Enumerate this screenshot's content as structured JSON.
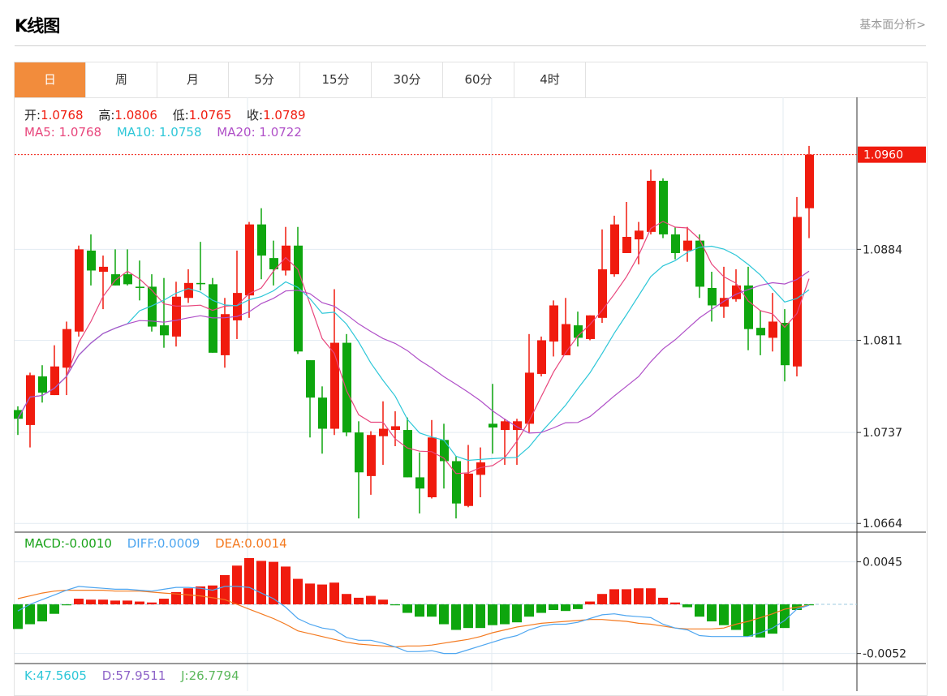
{
  "header": {
    "title": "K线图",
    "link": "基本面分析>"
  },
  "tabs": [
    {
      "label": "日",
      "active": true
    },
    {
      "label": "周"
    },
    {
      "label": "月"
    },
    {
      "label": "5分"
    },
    {
      "label": "15分"
    },
    {
      "label": "30分"
    },
    {
      "label": "60分"
    },
    {
      "label": "4时"
    }
  ],
  "ohlc_legend": {
    "open_label": "开:",
    "open": "1.0768",
    "high_label": "高:",
    "high": "1.0806",
    "low_label": "低:",
    "low": "1.0765",
    "close_label": "收:",
    "close": "1.0789"
  },
  "ma_legend": {
    "ma5_label": "MA5:",
    "ma5": "1.0768",
    "ma10_label": "MA10:",
    "ma10": "1.0758",
    "ma20_label": "MA20:",
    "ma20": "1.0722"
  },
  "macd_legend": {
    "macd_label": "MACD:",
    "macd": "-0.0010",
    "diff_label": "DIFF:",
    "diff": "0.0009",
    "dea_label": "DEA:",
    "dea": "0.0014"
  },
  "kdj_legend": {
    "k_label": "K:",
    "k": "47.5605",
    "d_label": "D:",
    "d": "57.9511",
    "j_label": "J:",
    "j": "26.7794"
  },
  "colors": {
    "up": "#f01b0e",
    "down": "#0ea60e",
    "ma5": "#e8467c",
    "ma10": "#2ec7d8",
    "ma20": "#b050c8",
    "diff": "#4ea6f0",
    "dea": "#f47a20",
    "active_tab": "#f28c3c"
  },
  "chart_data": [
    {
      "type": "candlestick",
      "title": "K线图",
      "ylim": [
        1.0657,
        1.1006
      ],
      "yticks": [
        "1.0884",
        "1.0811",
        "1.0737",
        "1.0664"
      ],
      "last_price": "1.0960",
      "ohlc": [
        [
          1.0755,
          1.0758,
          1.0735,
          1.0748
        ],
        [
          1.0743,
          1.0785,
          1.0725,
          1.0783
        ],
        [
          1.0782,
          1.0791,
          1.0761,
          1.0769
        ],
        [
          1.0767,
          1.0807,
          1.0767,
          1.079
        ],
        [
          1.0789,
          1.0826,
          1.0767,
          1.082
        ],
        [
          1.0818,
          1.0887,
          1.0814,
          1.0884
        ],
        [
          1.0883,
          1.0896,
          1.0855,
          1.0867
        ],
        [
          1.0866,
          1.0879,
          1.0836,
          1.087
        ],
        [
          1.0864,
          1.0884,
          1.0855,
          1.0855
        ],
        [
          1.0864,
          1.0884,
          1.0855,
          1.0856
        ],
        [
          1.0854,
          1.0875,
          1.0843,
          1.0853
        ],
        [
          1.0854,
          1.0864,
          1.0818,
          1.0822
        ],
        [
          1.0823,
          1.0861,
          1.0805,
          1.0815
        ],
        [
          1.0814,
          1.0858,
          1.0806,
          1.0846
        ],
        [
          1.0845,
          1.0868,
          1.0841,
          1.0857
        ],
        [
          1.0857,
          1.089,
          1.0851,
          1.0856
        ],
        [
          1.0856,
          1.0861,
          1.0801,
          1.0801
        ],
        [
          1.0799,
          1.0845,
          1.0789,
          1.0832
        ],
        [
          1.0827,
          1.0883,
          1.0812,
          1.0849
        ],
        [
          1.0847,
          1.0906,
          1.0829,
          1.0904
        ],
        [
          1.0904,
          1.0917,
          1.086,
          1.0879
        ],
        [
          1.0877,
          1.0891,
          1.0855,
          1.0868
        ],
        [
          1.0867,
          1.0902,
          1.0863,
          1.0887
        ],
        [
          1.0887,
          1.0902,
          1.08,
          1.0802
        ],
        [
          1.0795,
          1.0795,
          1.0733,
          1.0765
        ],
        [
          1.0765,
          1.0774,
          1.072,
          1.074
        ],
        [
          1.074,
          1.0852,
          1.0735,
          1.0809
        ],
        [
          1.0809,
          1.0816,
          1.0734,
          1.0737
        ],
        [
          1.0737,
          1.0746,
          1.0668,
          1.0705
        ],
        [
          1.0702,
          1.0738,
          1.0687,
          1.0735
        ],
        [
          1.0734,
          1.0762,
          1.0711,
          1.074
        ],
        [
          1.0739,
          1.0754,
          1.0726,
          1.0742
        ],
        [
          1.0739,
          1.0749,
          1.0701,
          1.0701
        ],
        [
          1.0701,
          1.0721,
          1.0672,
          1.0692
        ],
        [
          1.0685,
          1.0747,
          1.0684,
          1.0733
        ],
        [
          1.0731,
          1.0744,
          1.0692,
          1.0714
        ],
        [
          1.0714,
          1.0718,
          1.0668,
          1.068
        ],
        [
          1.0678,
          1.0727,
          1.0677,
          1.0704
        ],
        [
          1.0703,
          1.0725,
          1.0685,
          1.0713
        ],
        [
          1.0744,
          1.0776,
          1.072,
          1.0741
        ],
        [
          1.0739,
          1.0748,
          1.0711,
          1.0746
        ],
        [
          1.0739,
          1.0748,
          1.0711,
          1.0746
        ],
        [
          1.0744,
          1.0816,
          1.0737,
          1.0785
        ],
        [
          1.0784,
          1.0814,
          1.0782,
          1.0811
        ],
        [
          1.081,
          1.0843,
          1.0798,
          1.0839
        ],
        [
          1.0799,
          1.0845,
          1.0799,
          1.0824
        ],
        [
          1.0823,
          1.0834,
          1.0806,
          1.0813
        ],
        [
          1.0812,
          1.0831,
          1.0811,
          1.0831
        ],
        [
          1.0829,
          1.09,
          1.0825,
          1.0868
        ],
        [
          1.0864,
          1.0911,
          1.0862,
          1.0904
        ],
        [
          1.0881,
          1.0922,
          1.0881,
          1.0894
        ],
        [
          1.0892,
          1.0906,
          1.0872,
          1.0899
        ],
        [
          1.0898,
          1.0948,
          1.0896,
          1.0939
        ],
        [
          1.0939,
          1.0941,
          1.0893,
          1.0896
        ],
        [
          1.0896,
          1.0902,
          1.0876,
          1.0881
        ],
        [
          1.0883,
          1.0902,
          1.0874,
          1.0891
        ],
        [
          1.0891,
          1.0896,
          1.0845,
          1.0854
        ],
        [
          1.0853,
          1.0866,
          1.0826,
          1.0839
        ],
        [
          1.0838,
          1.087,
          1.0829,
          1.0845
        ],
        [
          1.0844,
          1.0868,
          1.0842,
          1.0855
        ],
        [
          1.0855,
          1.087,
          1.0803,
          1.082
        ],
        [
          1.0821,
          1.0835,
          1.0799,
          1.0815
        ],
        [
          1.0813,
          1.0849,
          1.0802,
          1.0826
        ],
        [
          1.0825,
          1.0836,
          1.0778,
          1.0791
        ],
        [
          1.079,
          1.0926,
          1.0782,
          1.091
        ],
        [
          1.0917,
          1.0967,
          1.0893,
          1.096
        ]
      ]
    },
    {
      "type": "bar+line",
      "title": "MACD",
      "ylim": [
        -0.00626,
        0.00764
      ],
      "yticks": [
        "0.0045",
        "-0.0052"
      ],
      "hist": [
        -0.0026,
        -0.0021,
        -0.0018,
        -0.001,
        -0.0001,
        0.0006,
        0.0005,
        0.0005,
        0.0004,
        0.0004,
        0.0003,
        0.0002,
        0.0006,
        0.0013,
        0.0017,
        0.0019,
        0.002,
        0.0031,
        0.0041,
        0.0049,
        0.0046,
        0.0045,
        0.004,
        0.0027,
        0.0022,
        0.0021,
        0.0023,
        0.0011,
        0.0007,
        0.0009,
        0.0005,
        -0.0001,
        -0.0009,
        -0.0013,
        -0.0013,
        -0.0021,
        -0.0027,
        -0.0025,
        -0.0025,
        -0.0022,
        -0.0021,
        -0.0019,
        -0.0013,
        -0.0009,
        -0.0006,
        -0.0007,
        -0.0005,
        0.0003,
        0.0011,
        0.0016,
        0.0016,
        0.0017,
        0.0017,
        0.0007,
        0.0002,
        -0.0003,
        -0.0013,
        -0.0018,
        -0.0022,
        -0.0027,
        -0.0034,
        -0.0035,
        -0.0031,
        -0.0025,
        -0.0006,
        -0.0001
      ],
      "diff": [
        -0.0007,
        0.0,
        0.0005,
        0.001,
        0.0015,
        0.0019,
        0.0018,
        0.0017,
        0.0016,
        0.0016,
        0.0015,
        0.0014,
        0.0016,
        0.0018,
        0.0018,
        0.0017,
        0.0015,
        0.0019,
        0.0019,
        0.0018,
        0.0012,
        0.0006,
        -0.0003,
        -0.0015,
        -0.0021,
        -0.0025,
        -0.0027,
        -0.0035,
        -0.0038,
        -0.0038,
        -0.0041,
        -0.0045,
        -0.005,
        -0.005,
        -0.0049,
        -0.0052,
        -0.0052,
        -0.0048,
        -0.0044,
        -0.004,
        -0.0036,
        -0.0033,
        -0.0027,
        -0.0023,
        -0.0021,
        -0.0021,
        -0.0019,
        -0.0015,
        -0.0011,
        -0.001,
        -0.0012,
        -0.0013,
        -0.0014,
        -0.0021,
        -0.0025,
        -0.0027,
        -0.0033,
        -0.0034,
        -0.0034,
        -0.0034,
        -0.0034,
        -0.003,
        -0.0025,
        -0.0017,
        -0.0005,
        -0.0001
      ],
      "dea": [
        0.0006,
        0.0009,
        0.0012,
        0.0014,
        0.0015,
        0.0015,
        0.0015,
        0.0015,
        0.0014,
        0.0014,
        0.0014,
        0.0013,
        0.0012,
        0.0011,
        0.001,
        0.0009,
        0.0007,
        0.0005,
        0.0,
        -0.0005,
        -0.001,
        -0.0015,
        -0.0021,
        -0.0028,
        -0.0031,
        -0.0034,
        -0.0037,
        -0.004,
        -0.0042,
        -0.0043,
        -0.0044,
        -0.0045,
        -0.0044,
        -0.0044,
        -0.0043,
        -0.0041,
        -0.0039,
        -0.0037,
        -0.0034,
        -0.003,
        -0.0027,
        -0.0024,
        -0.0022,
        -0.002,
        -0.0019,
        -0.0018,
        -0.0017,
        -0.0016,
        -0.0016,
        -0.0017,
        -0.0018,
        -0.002,
        -0.0021,
        -0.0023,
        -0.0025,
        -0.0026,
        -0.0026,
        -0.0026,
        -0.0025,
        -0.0021,
        -0.0018,
        -0.0014,
        -0.001,
        -0.0005,
        -0.0003,
        -0.0001
      ]
    }
  ]
}
